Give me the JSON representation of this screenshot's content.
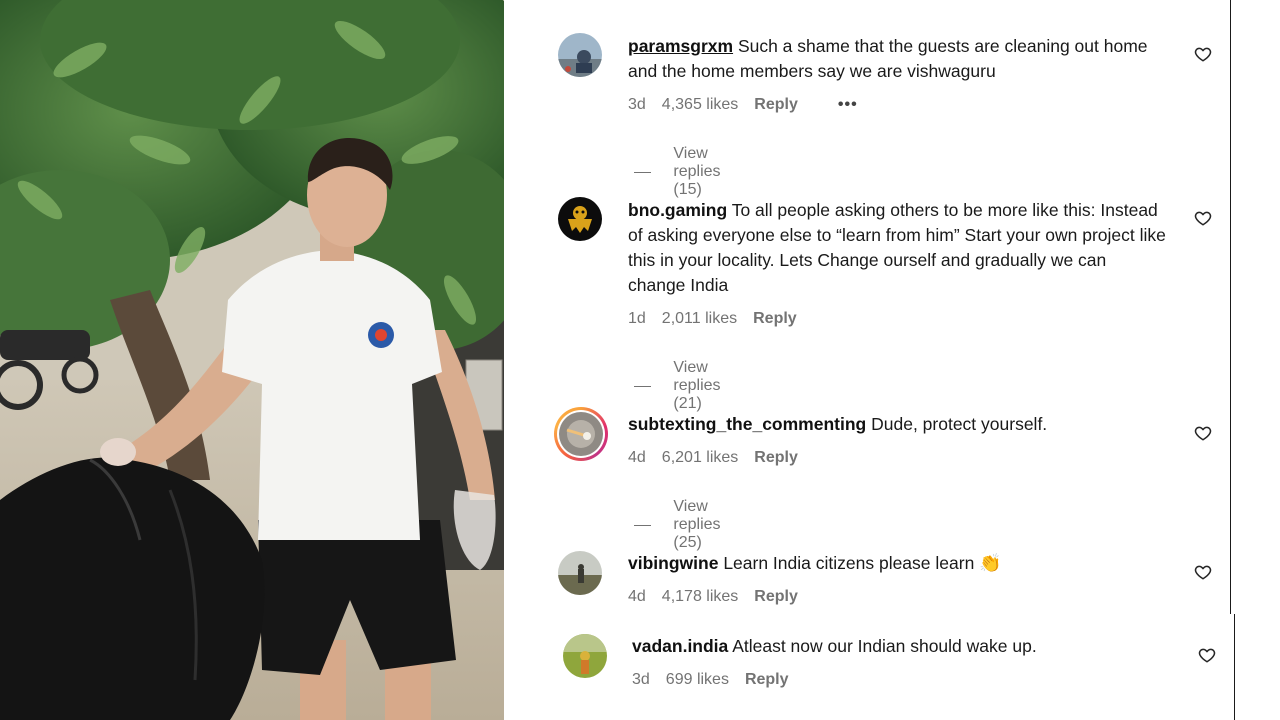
{
  "comments": [
    {
      "username": "paramsgrxm",
      "text": "Such a shame that the guests are cleaning out home and the home members say we are vishwaguru",
      "age": "3d",
      "likes": "4,365 likes",
      "reply": "Reply",
      "more": "•••",
      "view_replies": "View replies (15)"
    },
    {
      "username": "bno.gaming",
      "text": "To all people asking others to be more like this: Instead of asking everyone else to “learn from him” Start your own project like this in your locality. Lets Change ourself and gradually we can change India",
      "age": "1d",
      "likes": "2,011 likes",
      "reply": "Reply",
      "view_replies": "View replies (21)"
    },
    {
      "username": "subtexting_the_commenting",
      "text": "Dude, protect yourself.",
      "age": "4d",
      "likes": "6,201 likes",
      "reply": "Reply",
      "view_replies": "View replies (25)"
    },
    {
      "username": "vibingwine",
      "text": "Learn India citizens please learn",
      "emoji": "👏",
      "age": "4d",
      "likes": "4,178 likes",
      "reply": "Reply"
    },
    {
      "username": "vadan.india",
      "text": "Atleast now our Indian should wake up.",
      "age": "3d",
      "likes": "699 likes",
      "reply": "Reply"
    }
  ],
  "icons": {
    "like": "heart-icon",
    "more": "more-options-icon"
  },
  "colors": {
    "meta_text": "#737373",
    "story_ring": [
      "#fcaf45",
      "#e1306c",
      "#c13584"
    ]
  }
}
